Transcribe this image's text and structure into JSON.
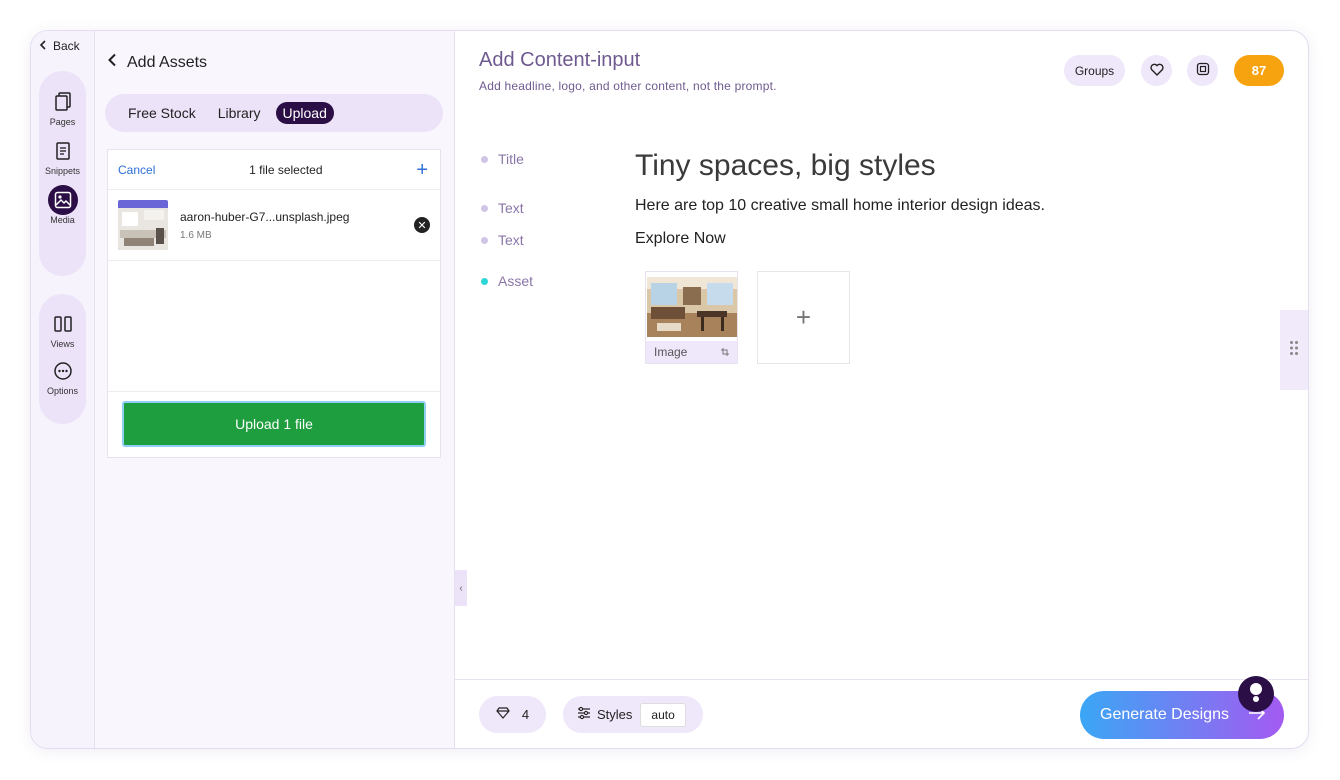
{
  "nav": {
    "back_label": "Back"
  },
  "rail": {
    "items": [
      {
        "label": "Pages",
        "icon": "pages-icon"
      },
      {
        "label": "Snippets",
        "icon": "snippets-icon"
      },
      {
        "label": "Media",
        "icon": "media-icon",
        "active": true
      },
      {
        "label": "Views",
        "icon": "views-icon"
      },
      {
        "label": "Options",
        "icon": "options-icon"
      }
    ]
  },
  "assets": {
    "title": "Add Assets",
    "tabs": [
      "Free Stock",
      "Library",
      "Upload"
    ],
    "selected_tab": "Upload",
    "uploader": {
      "cancel_label": "Cancel",
      "status": "1 file selected",
      "file": {
        "name": "aaron-huber-G7...unsplash.jpeg",
        "size": "1.6 MB"
      },
      "upload_button": "Upload 1 file"
    }
  },
  "content": {
    "title": "Add Content-input",
    "subtitle": "Add headline, logo, and other content, not the prompt.",
    "groups_label": "Groups",
    "credits": "87",
    "fields": [
      {
        "label": "Title",
        "value": "Tiny spaces, big styles"
      },
      {
        "label": "Text",
        "value": "Here are top 10 creative small home interior design ideas."
      },
      {
        "label": "Text",
        "value": "Explore Now"
      },
      {
        "label": "Asset",
        "value": ""
      }
    ],
    "asset_card_label": "Image"
  },
  "footer": {
    "gems": "4",
    "styles_label": "Styles",
    "styles_value": "auto",
    "generate_label": "Generate Designs"
  },
  "colors": {
    "accent_dark": "#2b0e45",
    "accent_purple": "#6f5a90",
    "credits": "#f7a30f",
    "upload_green": "#1e9e3e",
    "gradient_start": "#3aa7f5",
    "gradient_end": "#a45af1"
  }
}
